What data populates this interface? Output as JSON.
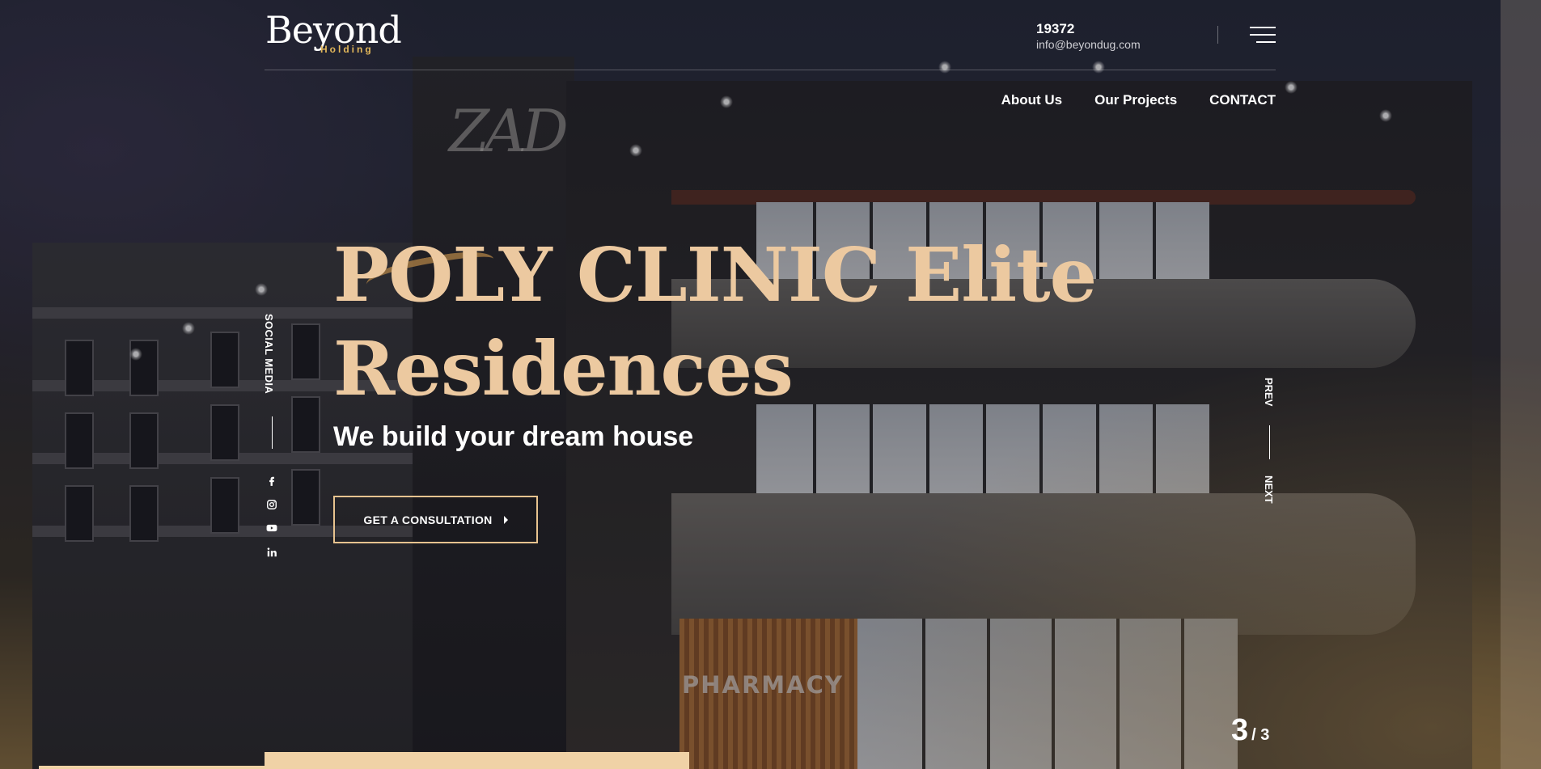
{
  "header": {
    "logo_word": "Beyond",
    "logo_sub": "Holding",
    "phone": "19372",
    "email": "info@beyondug.com"
  },
  "nav": {
    "items": [
      {
        "label": "About Us"
      },
      {
        "label": "Our Projects"
      },
      {
        "label": "CONTACT"
      }
    ]
  },
  "hero": {
    "title_line1": "POLY CLINIC Elite",
    "title_line2": "Residences",
    "subtitle": "We build your dream house",
    "cta_label": "GET A CONSULTATION"
  },
  "background": {
    "sign_text": "ZAD",
    "pharmacy_text": "PHARMACY"
  },
  "social": {
    "label": "SOCIAL MEDIA",
    "icons": [
      "facebook-icon",
      "instagram-icon",
      "youtube-icon",
      "linkedin-icon"
    ]
  },
  "slider": {
    "prev_label": "PREV",
    "next_label": "NEXT",
    "current": "3",
    "total": "/ 3"
  },
  "colors": {
    "accent_gold": "#ecc9a0",
    "logo_gold": "#e2b75a",
    "cta_border": "#e7c38f"
  }
}
